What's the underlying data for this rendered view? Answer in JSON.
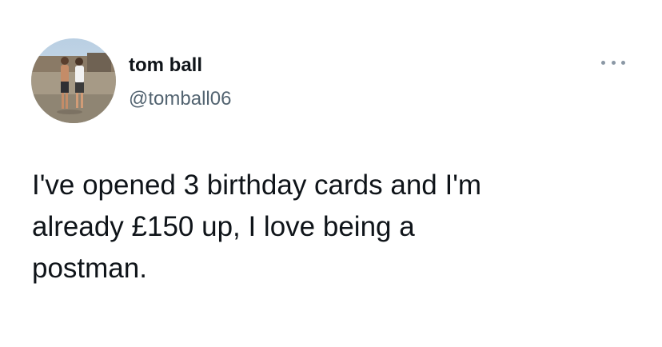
{
  "author": {
    "display_name": "tom ball",
    "handle": "@tomball06",
    "avatar_icon": "profile-photo-two-people"
  },
  "menu": {
    "more_icon": "more-options-icon"
  },
  "tweet": {
    "lines": [
      "I've opened 3 birthday cards and I'm",
      "already £150 up, I love being a",
      "postman."
    ]
  },
  "colors": {
    "text_primary": "#0f1419",
    "text_secondary": "#536471",
    "background": "#ffffff"
  }
}
